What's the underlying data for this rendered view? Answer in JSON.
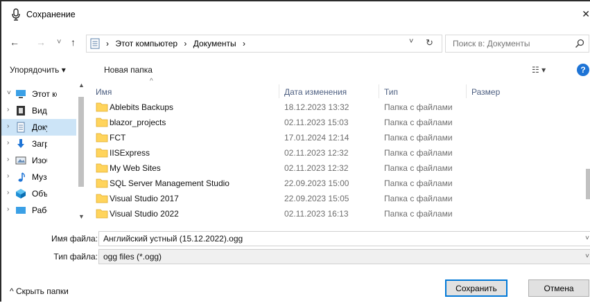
{
  "window": {
    "title": "Сохранение",
    "close": "✕"
  },
  "nav": {
    "back": "←",
    "forward": "→",
    "recent": "˅",
    "up": "↑"
  },
  "address": {
    "crumbs": [
      "›",
      "Этот компьютер",
      "›",
      "Документы",
      "›"
    ],
    "dropdown": "˅",
    "refresh": "↻"
  },
  "search": {
    "placeholder": "Поиск в: Документы"
  },
  "toolbar": {
    "organize": "Упорядочить ▾",
    "new_folder": "Новая папка",
    "view": "☷ ▾",
    "help": "?"
  },
  "tree": {
    "items": [
      {
        "chevron": "˅",
        "label": "Этот компьютер",
        "icon": "computer-icon"
      },
      {
        "chevron": "›",
        "label": "Видео",
        "icon": "video-icon"
      },
      {
        "chevron": "›",
        "label": "Документы",
        "icon": "documents-icon",
        "selected": true
      },
      {
        "chevron": "›",
        "label": "Загрузки",
        "icon": "download-icon"
      },
      {
        "chevron": "›",
        "label": "Изображения",
        "icon": "pictures-icon"
      },
      {
        "chevron": "›",
        "label": "Музыка",
        "icon": "music-icon"
      },
      {
        "chevron": "›",
        "label": "Объемные объекты",
        "icon": "3d-objects-icon"
      },
      {
        "chevron": "›",
        "label": "Рабочий стол",
        "icon": "desktop-icon"
      }
    ]
  },
  "list": {
    "sort_indicator": "^",
    "columns": {
      "name": "Имя",
      "date": "Дата изменения",
      "type": "Тип",
      "size": "Размер"
    },
    "rows": [
      {
        "name": "Ablebits Backups",
        "date": "18.12.2023 13:32",
        "type": "Папка с файлами"
      },
      {
        "name": "blazor_projects",
        "date": "02.11.2023 15:03",
        "type": "Папка с файлами"
      },
      {
        "name": "FCT",
        "date": "17.01.2024 12:14",
        "type": "Папка с файлами"
      },
      {
        "name": "IISExpress",
        "date": "02.11.2023 12:32",
        "type": "Папка с файлами"
      },
      {
        "name": "My Web Sites",
        "date": "02.11.2023 12:32",
        "type": "Папка с файлами"
      },
      {
        "name": "SQL Server Management Studio",
        "date": "22.09.2023 15:00",
        "type": "Папка с файлами"
      },
      {
        "name": "Visual Studio 2017",
        "date": "22.09.2023 15:05",
        "type": "Папка с файлами"
      },
      {
        "name": "Visual Studio 2022",
        "date": "02.11.2023 16:13",
        "type": "Папка с файлами"
      }
    ]
  },
  "filename": {
    "label": "Имя файла:",
    "value": "Английский устный (15.12.2022).ogg",
    "dropdown": "˅"
  },
  "filetype": {
    "label": "Тип файла:",
    "value": "ogg files (*.ogg)",
    "dropdown": "˅"
  },
  "footer": {
    "hide_folders": "^  Скрыть папки",
    "save": "Сохранить",
    "cancel": "Отмена"
  },
  "colors": {
    "selection": "#cce4f7",
    "folder": "#ffd45c",
    "accent": "#0078d7",
    "help": "#1e74d6"
  }
}
